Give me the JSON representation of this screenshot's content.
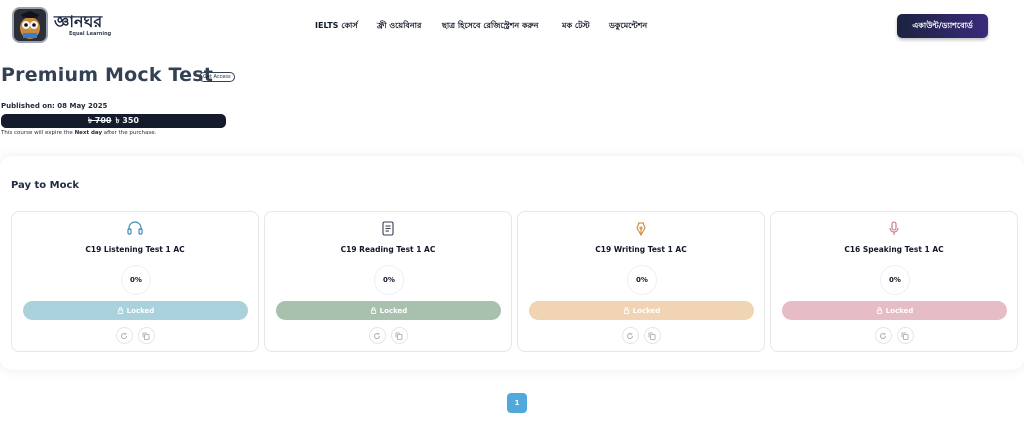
{
  "brand": {
    "name": "জ্ঞানঘর",
    "tagline": "Equal Learning",
    "logo_icon": "owl-mascot-icon"
  },
  "nav": {
    "items": [
      {
        "label": "IELTS কোর্স"
      },
      {
        "label": "ফ্রী ওয়েবিনার"
      },
      {
        "label": "ছাত্র হিসেবে রেজিস্ট্রেশন করুন"
      },
      {
        "label": "মক টেস্ট"
      },
      {
        "label": "ডকুমেন্টেশন"
      }
    ],
    "account_label": "একাউন্ট/ড্যাশবোর্ড"
  },
  "course": {
    "title": "Premium Mock Test",
    "access_badge": "Get Access",
    "published": "Published on: 08 May 2025",
    "price_old": "৳ 700",
    "price_new": "৳ 350",
    "expiry_prefix": "This course will expire the ",
    "expiry_bold": "Next day",
    "expiry_suffix": " after the purchase."
  },
  "mock": {
    "section_title": "Pay to Mock",
    "cards": [
      {
        "title": "C19 Listening Test 1 AC",
        "icon": "headphones-icon",
        "progress": "0%",
        "status": "Locked",
        "color": "#a9d2dc",
        "icon_color": "#3b8fb0"
      },
      {
        "title": "C19 Reading Test 1 AC",
        "icon": "document-icon",
        "progress": "0%",
        "status": "Locked",
        "color": "#a8c1ae",
        "icon_color": "#374151"
      },
      {
        "title": "C19 Writing Test 1 AC",
        "icon": "pen-nib-icon",
        "progress": "0%",
        "status": "Locked",
        "color": "#f0d4b4",
        "icon_color": "#d08a3a"
      },
      {
        "title": "C16 Speaking Test 1 AC",
        "icon": "microphone-icon",
        "progress": "0%",
        "status": "Locked",
        "color": "#e6bcc5",
        "icon_color": "#c9707f"
      }
    ]
  },
  "pagination": {
    "current_page": "1"
  }
}
